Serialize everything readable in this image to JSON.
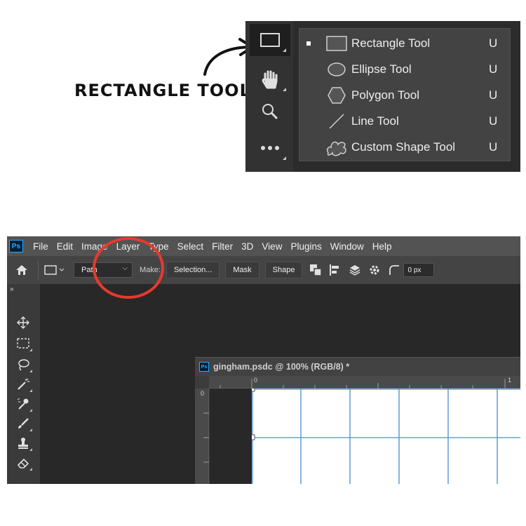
{
  "callout": {
    "label": "RECTANGLE TOOL"
  },
  "flyout": {
    "items": [
      {
        "label": "Rectangle Tool",
        "shortcut": "U",
        "icon": "rectangle-icon",
        "selected": true
      },
      {
        "label": "Ellipse Tool",
        "shortcut": "U",
        "icon": "ellipse-icon",
        "selected": false
      },
      {
        "label": "Polygon Tool",
        "shortcut": "U",
        "icon": "polygon-icon",
        "selected": false
      },
      {
        "label": "Line Tool",
        "shortcut": "U",
        "icon": "line-icon",
        "selected": false
      },
      {
        "label": "Custom Shape Tool",
        "shortcut": "U",
        "icon": "custom-shape-icon",
        "selected": false
      }
    ],
    "strip_icons": [
      "rectangle-icon",
      "hand-icon",
      "zoom-icon",
      "more-icon"
    ]
  },
  "app": {
    "logo": "Ps",
    "menu": [
      "File",
      "Edit",
      "Image",
      "Layer",
      "Type",
      "Select",
      "Filter",
      "3D",
      "View",
      "Plugins",
      "Window",
      "Help"
    ]
  },
  "options": {
    "mode_value": "Path",
    "make_label": "Make:",
    "selection_button": "Selection...",
    "mask_button": "Mask",
    "shape_button": "Shape",
    "radius_value": "0 px"
  },
  "tools": {
    "expand": "»",
    "icons": [
      "move-icon",
      "marquee-icon",
      "lasso-icon",
      "magic-wand-icon",
      "eyedropper-icon",
      "brush-icon",
      "stamp-icon",
      "eraser-icon"
    ]
  },
  "document": {
    "title": "gingham.psdc @ 100% (RGB/8) *",
    "ruler_top_labels": [
      "0",
      "1"
    ],
    "ruler_left_labels": [
      "0"
    ]
  },
  "colors": {
    "highlight": "#e63a2e",
    "grid_line": "#6a9fd8",
    "accent": "#31a8ff"
  }
}
